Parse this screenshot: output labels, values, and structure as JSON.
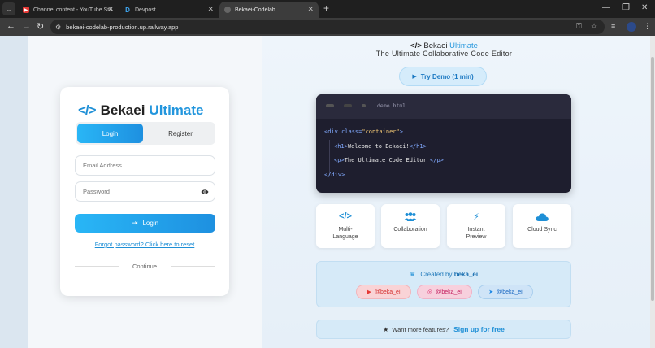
{
  "browser": {
    "tabs": [
      {
        "title": "Channel content - YouTube Stu",
        "favicon": "youtube-icon"
      },
      {
        "title": "Devpost",
        "favicon": "devpost-icon"
      },
      {
        "title": "Bekaei-Codelab",
        "favicon": "globe-icon",
        "active": true
      }
    ],
    "url": "bekaei-codelab-production.up.railway.app"
  },
  "login": {
    "brand_word1": "Bekaei",
    "brand_word2": "Ultimate",
    "tab_login": "Login",
    "tab_register": "Register",
    "email_placeholder": "Email Address",
    "password_placeholder": "Password",
    "login_button": "Login",
    "forgot_link": "Forgot password? Click here to reset",
    "continue_label": "Continue"
  },
  "hero": {
    "title_word1": "Bekaei",
    "title_word2": "Ultimate",
    "subtitle": "The Ultimate Collaborative Code Editor",
    "demo_button": "Try Demo (1 min)"
  },
  "editor": {
    "filename": "demo.html",
    "lines": [
      {
        "tag_open": "<div class=",
        "string": "\"container\"",
        "tag_close": ">"
      },
      {
        "tag_open": "<h1>",
        "text": "Welcome to Bekaei!",
        "tag_close": "</h1>"
      },
      {
        "tag_open": "<p>",
        "text": "The Ultimate Code Editor ",
        "tag_close": "</p>"
      },
      {
        "tag_open": "</div>"
      }
    ]
  },
  "features": [
    {
      "label_line1": "Multi-",
      "label_line2": "Language",
      "icon": "code-icon"
    },
    {
      "label_line1": "Collaboration",
      "label_line2": "",
      "icon": "users-icon"
    },
    {
      "label_line1": "Instant",
      "label_line2": "Preview",
      "icon": "bolt-icon"
    },
    {
      "label_line1": "Cloud Sync",
      "label_line2": "",
      "icon": "cloud-icon"
    }
  ],
  "credits": {
    "created_by": "Created by",
    "author": "beka_ei",
    "socials": [
      {
        "handle": "@beka_ei",
        "icon": "youtube-icon",
        "color": "#e53935"
      },
      {
        "handle": "@beka_ei",
        "icon": "instagram-icon",
        "color": "#d81b60"
      },
      {
        "handle": "@beka_ei",
        "icon": "telegram-icon",
        "color": "#1e88e5"
      }
    ]
  },
  "signup": {
    "prompt": "Want more features?",
    "link": "Sign up for free"
  },
  "colors": {
    "accent": "#1e90e0",
    "accent_light": "#29b6f6"
  }
}
